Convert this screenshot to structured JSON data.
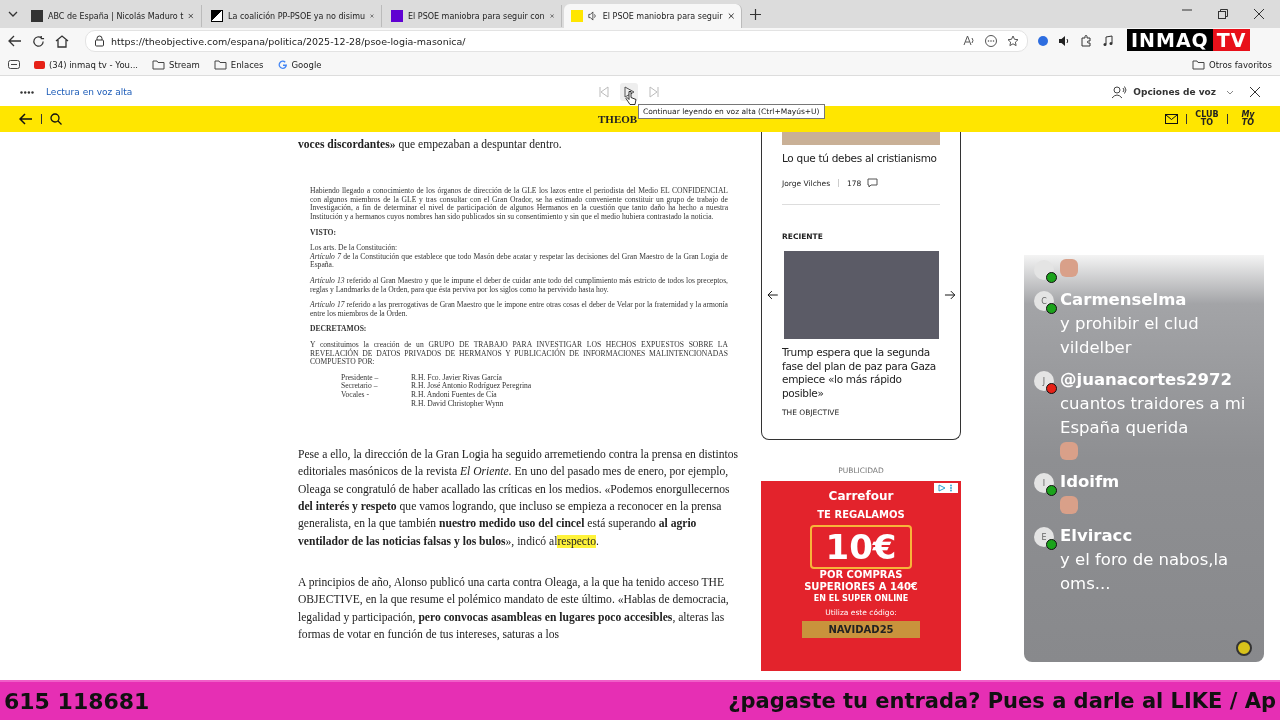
{
  "browser": {
    "tabs": [
      {
        "title": "ABC de España | Nicolás Maduro t",
        "kind": "abc",
        "selected": false,
        "audio": false
      },
      {
        "title": "La coalición PP-PSOE ya no disimu",
        "kind": "bw",
        "selected": false,
        "audio": false
      },
      {
        "title": "El PSOE maniobra para seguir con",
        "kind": "yahoo",
        "selected": false,
        "audio": false
      },
      {
        "title": "El PSOE maniobra para seguir",
        "kind": "to",
        "selected": true,
        "audio": true
      }
    ],
    "url": "https://theobjective.com/espana/politica/2025-12-28/psoe-logia-masonica/",
    "bookmarks": [
      {
        "label": "(34) inmaq tv - You...",
        "kind": "youtube"
      },
      {
        "label": "Stream",
        "kind": "folder"
      },
      {
        "label": "Enlaces",
        "kind": "folder"
      },
      {
        "label": "Google",
        "kind": "google"
      }
    ],
    "other_favorites": "Otros favoritos"
  },
  "read_aloud": {
    "label": "Lectura en voz alta",
    "voice_options": "Opciones de voz",
    "tooltip": "Continuar leyendo en voz alta (Ctrl+Mayús+U)"
  },
  "site_header": {
    "logo": "THEOB",
    "club": "CLUB TO",
    "my": "My TO"
  },
  "article": {
    "lead": "**voces discordantes»** que empezaban a despuntar dentro.",
    "document": {
      "blocks": [
        {
          "kind": "para",
          "text": "Habiendo llegado a conocimiento de los órganos de dirección de la GLE los lazos entre el periodista del Medio EL CONFIDENCIAL con algunos miembros de la GLE  y tras consultar con el Gran Orador, se ha estimado conveniente constituir un grupo de trabajo de Investigación, a fin de determinar el nivel de participación de algunos Hermanos en la cuestión que tanto daño ha hecho a nuestra Institución y a hermanos cuyos nombres han sido publicados sin su consentimiento y sin que el medio hubiera contrastado la noticia."
        },
        {
          "kind": "heading",
          "text": "VISTO:"
        },
        {
          "kind": "line",
          "text": "Los arts. De la Constitución:"
        },
        {
          "kind": "para",
          "text": "*Artículo 7* de la Constitución que establece que todo Masón debe acatar y respetar las decisiones del Gran Maestro de la Gran Logia de España."
        },
        {
          "kind": "para",
          "text": "*Artículo 13* referido al Gran Maestro y que le impune el deber de cuidar ante todo del cumplimiento más estricto de todos los preceptos, reglas y Landmarks de la Orden, para que ésta perviva por los siglos como ha pervivido hasta hoy."
        },
        {
          "kind": "para",
          "text": "*Artículo 17* referido a las prerrogativas de Gran Maestro que le impone entre otras cosas el deber de Velar por la fraternidad y la armonía entre los miembros de la Orden."
        },
        {
          "kind": "heading",
          "text": "DECRETAMOS:"
        },
        {
          "kind": "para",
          "text": "Y constituimos la creación de un GRUPO DE TRABAJO PARA INVESTIGAR LOS HECHOS EXPUESTOS SOBRE LA REVELACIÓN DE DATOS PRIVADOS DE HERMANOS Y PUBLICACIÓN DE INFORMACIONES MALINTENCIONADAS COMPUESTO POR:"
        }
      ],
      "members": [
        {
          "role": "Presidente –",
          "name": "R.H. Fco. Javier Rivas García"
        },
        {
          "role": "Secretario –",
          "name": "R.H. José Antonio Rodríguez Peregrina"
        },
        {
          "role": "Vocales -",
          "name": "R.H. Andoni Fuentes de Cía"
        },
        {
          "name": "R.H. David Christopher Wynn"
        }
      ]
    },
    "paragraphs": [
      {
        "text": "Pese a ello, la dirección de la Gran Logia ha seguido arremetiendo contra la prensa en distintos editoriales masónicos de la revista *El Oriente*. En uno del pasado mes de enero, por ejemplo, Oleaga se congratuló de haber acallado las críticas en los medios. «Podemos enorgullecernos **del interés y respeto** que vamos logrando, que incluso se empieza a reconocer en la prensa generalista, en la que también **nuestro medido uso del cincel** está superando **al agrio ventilador de las noticias falsas y los bulos**», indicó al",
        "highlight": "respecto",
        "after": "."
      },
      {
        "text": "A principios de año, Alonso publicó una carta contra Oleaga, a la que ha tenido acceso THE OBJECTIVE, en la que resume el polémico mandato de este último. «Hablas de democracia, legalidad y participación, **pero convocas asambleas en lugares poco accesibles**, alteras las formas de votar en función de tus intereses, saturas a los"
      }
    ]
  },
  "sidebar": {
    "top_story": {
      "title": "Lo que tú debes al cristianismo",
      "author": "Jorge Vilches",
      "comments": "178"
    },
    "recent": {
      "heading": "RECIENTE",
      "title": "Trump espera que la segunda fase del plan de paz para Gaza empiece «lo más rápido posible»",
      "source": "THE OBJECTIVE"
    },
    "ad": {
      "label": "PUBLICIDAD",
      "brand": "Carrefour",
      "headline": "TE REGALAMOS",
      "amount": "10€",
      "line1": "POR COMPRAS",
      "line2": "SUPERIORES A 140€",
      "line3": "EN EL SUPER ONLINE",
      "code_label": "Utiliza este código:",
      "code": "NAVIDAD25"
    }
  },
  "stream_overlay": {
    "logo_left": "INMAQ",
    "logo_right": "TV",
    "ticker_number": "615 118681",
    "ticker_text": "¿pagaste tu entrada? Pues a darle al LIKE / Ap",
    "chat": [
      {
        "color": "#1ba31b",
        "emote": true
      },
      {
        "user": "Carmenselma",
        "initial": "C",
        "color": "#1ba31b",
        "text": "y prohibir el clud vildelber",
        "emote": false
      },
      {
        "user": "@juanacortes2972",
        "initial": "J",
        "color": "#e62117",
        "text": "cuantos traidores a mi España querida",
        "emote": true
      },
      {
        "user": "Idoifm",
        "initial": "I",
        "color": "#1ba31b",
        "emote": true
      },
      {
        "user": "Elviracc",
        "initial": "E",
        "color": "#1ba31b",
        "text": "y el foro de nabos,la oms...",
        "emote": false
      }
    ]
  }
}
